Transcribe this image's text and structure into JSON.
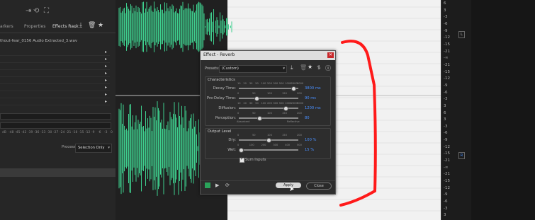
{
  "panel": {
    "tabs": [
      "arkers",
      "Properties",
      "Effects Rack"
    ],
    "file_name": "thout-fear_0156 Audio Extracted_3.wav",
    "process_label": "Process:",
    "process_value": "Selection Only",
    "meter_scale": [
      "dB",
      "-48",
      "-45",
      "-42",
      "-39",
      "-36",
      "-33",
      "-30",
      "-27",
      "-24",
      "-21",
      "-18",
      "-15",
      "-12",
      "-9",
      "-6",
      "-3",
      "0"
    ]
  },
  "ruler": {
    "labels": [
      "6",
      "3",
      "-3",
      "-6",
      "-9",
      "-12",
      "-15",
      "-21",
      "-∞",
      "-21",
      "-15",
      "-12",
      "-9",
      "-6",
      "-3",
      "3",
      "6",
      "3",
      "-3",
      "-6",
      "-9",
      "-12",
      "-15",
      "-21",
      "-∞",
      "-21",
      "-15",
      "-12",
      "-9",
      "-6",
      "-3",
      "3"
    ],
    "channel_badges": [
      "L",
      "R"
    ]
  },
  "dialog": {
    "title": "Effect - Reverb",
    "presets_label": "Presets:",
    "presets_value": "(Custom)",
    "characteristics_label": "Characteristics",
    "decay": {
      "label": "Decay Time:",
      "value": "3800 ms",
      "ticks": [
        "10",
        "20",
        "30",
        "50",
        "100",
        "200",
        "300",
        "500",
        "1000",
        "2000",
        "5000"
      ],
      "level": 0.92
    },
    "predelay": {
      "label": "Pre-Delay Time:",
      "value": "90 ms",
      "ticks": [
        "0",
        "50",
        "100",
        "150",
        "200"
      ],
      "level": 0.3
    },
    "diffusion": {
      "label": "Diffusion:",
      "value": "1200 ms",
      "ticks": [
        "10",
        "20",
        "30",
        "50",
        "100",
        "200",
        "300",
        "500",
        "1000",
        "2000",
        "5000"
      ],
      "level": 0.78
    },
    "perception": {
      "label": "Perception:",
      "value": "80",
      "ticks": [
        "0",
        "50",
        "100",
        "150",
        "200"
      ],
      "level": 0.35,
      "left_caption": "Absorbent",
      "right_caption": "Reflective"
    },
    "output_label": "Output Level",
    "dry": {
      "label": "Dry:",
      "value": "100 %",
      "ticks": [
        "0",
        "50",
        "100",
        "150",
        "200"
      ],
      "level": 0.5
    },
    "wet": {
      "label": "Wet:",
      "value": "15 %",
      "ticks": [
        "0",
        "100",
        "200",
        "300",
        "400",
        "500"
      ],
      "level": 0.03
    },
    "sum_inputs_label": "Sum Inputs",
    "apply_label": "Apply",
    "close_label": "Close"
  },
  "colors": {
    "waveform": "#3ecf8e",
    "annotation": "#ff1a1a",
    "accent_blue": "#4a90ff"
  }
}
